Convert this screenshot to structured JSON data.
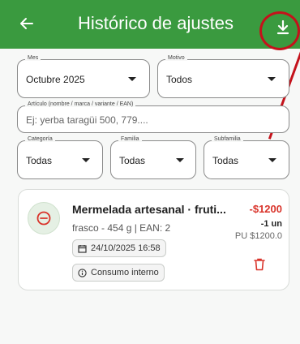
{
  "appbar": {
    "title": "Histórico de ajustes"
  },
  "filters": {
    "mes": {
      "label": "Mes",
      "value": "Octubre 2025"
    },
    "motivo": {
      "label": "Motivo",
      "value": "Todos"
    },
    "articulo": {
      "label": "Artículo (nombre / marca / variante / EAN)",
      "placeholder": "Ej: yerba taragüi 500, 779...."
    },
    "categoria": {
      "label": "Categoría",
      "value": "Todas"
    },
    "familia": {
      "label": "Familia",
      "value": "Todas"
    },
    "subfamilia": {
      "label": "Subfamilia",
      "value": "Todas"
    }
  },
  "entry": {
    "name": "Mermelada artesanal · fruti...",
    "details": "frasco - 454 g | EAN: 2",
    "date": "24/10/2025 16:58",
    "reason": "Consumo interno",
    "amount": "-$1200",
    "quantity": "-1 un",
    "unit_price": "PU $1200.0"
  },
  "colors": {
    "primary": "#3a9a3f",
    "negative": "#d9342b",
    "annotation": "#c4121b"
  },
  "icons": [
    "back-arrow-icon",
    "download-icon",
    "minus-circle-icon",
    "calendar-icon",
    "info-icon",
    "trash-icon",
    "chevron-down-icon"
  ]
}
